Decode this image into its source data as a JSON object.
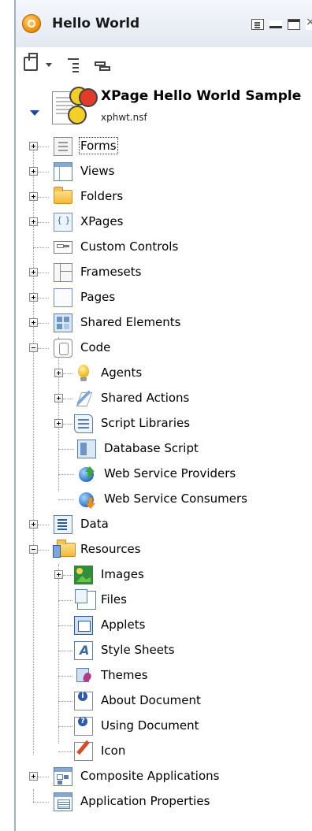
{
  "panel": {
    "title": "Hello World",
    "icons": [
      "designer-icon",
      "document-icon",
      "minimize-icon",
      "maximize-icon",
      "close-icon"
    ]
  },
  "toolbar": {
    "icons": [
      "new-icon",
      "dropdown-arrow-icon",
      "collapse-all-icon",
      "link-icon"
    ]
  },
  "database": {
    "title": "XPage Hello World Sample",
    "file": "xphwt.nsf"
  },
  "tree": {
    "forms": "Forms",
    "views": "Views",
    "folders": "Folders",
    "xpages": "XPages",
    "custom_controls": "Custom Controls",
    "framesets": "Framesets",
    "pages": "Pages",
    "shared_elements": "Shared Elements",
    "code": "Code",
    "agents": "Agents",
    "shared_actions": "Shared Actions",
    "script_libraries": "Script Libraries",
    "database_script": "Database Script",
    "web_service_providers": "Web Service Providers",
    "web_service_consumers": "Web Service Consumers",
    "data": "Data",
    "resources": "Resources",
    "images": "Images",
    "files": "Files",
    "applets": "Applets",
    "style_sheets": "Style Sheets",
    "themes": "Themes",
    "about_document": "About Document",
    "using_document": "Using Document",
    "icon": "Icon",
    "composite_applications": "Composite Applications",
    "application_properties": "Application Properties"
  }
}
